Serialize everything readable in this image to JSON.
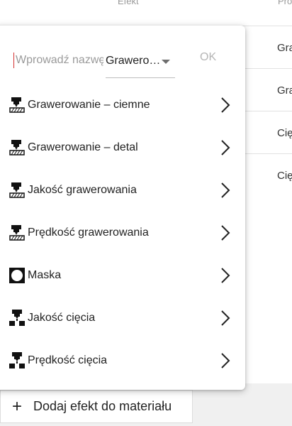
{
  "background": {
    "column_headers": [
      "Efekt",
      "Pro"
    ],
    "cells": [
      "Gra",
      "Gra",
      "Cię",
      "Cię"
    ]
  },
  "footer": {
    "add_button_label": "Dodaj efekt do materiału"
  },
  "popup": {
    "search": {
      "placeholder": "Wprowadź nazwę",
      "value": ""
    },
    "filter": {
      "selected": "Grawero…"
    },
    "ok_label": "OK",
    "items": [
      {
        "label": "Grawerowanie – ciemne",
        "icon": "engrave-icon"
      },
      {
        "label": "Grawerowanie – detal",
        "icon": "engrave-icon"
      },
      {
        "label": "Jakość grawerowania",
        "icon": "engrave-icon"
      },
      {
        "label": "Prędkość grawerowania",
        "icon": "engrave-icon"
      },
      {
        "label": "Maska",
        "icon": "mask-icon"
      },
      {
        "label": "Jakość cięcia",
        "icon": "cut-icon"
      },
      {
        "label": "Prędkość cięcia",
        "icon": "cut-icon"
      }
    ]
  },
  "colors": {
    "text": "#222222",
    "muted": "#9a9a9a",
    "caret": "#d32f2f"
  }
}
